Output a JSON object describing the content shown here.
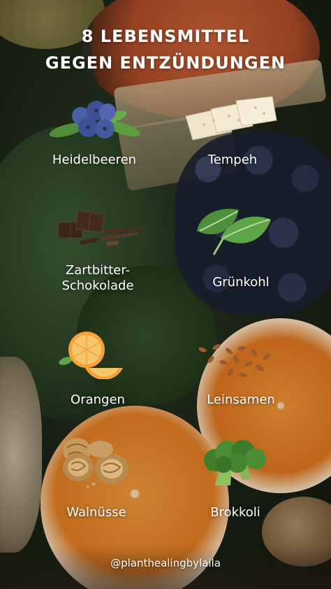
{
  "title": {
    "line1": "8 LEBENSMITTEL",
    "line2": "GEGEN ENTZÜNDUNGEN"
  },
  "foods": {
    "heidelbeeren": {
      "label": "Heidelbeeren",
      "icon": "blueberries-icon"
    },
    "tempeh": {
      "label": "Tempeh",
      "icon": "tempeh-icon"
    },
    "zartbitter": {
      "line1": "Zartbitter-",
      "line2": "Schokolade",
      "icon": "dark-chocolate-icon"
    },
    "gruenkohl": {
      "label": "Grünkohl",
      "icon": "kale-icon"
    },
    "orangen": {
      "label": "Orangen",
      "icon": "orange-slices-icon"
    },
    "leinsamen": {
      "label": "Leinsamen",
      "icon": "flaxseed-icon"
    },
    "walnuesse": {
      "label": "Walnüsse",
      "icon": "walnuts-icon"
    },
    "brokkoli": {
      "label": "Brokkoli",
      "icon": "broccoli-icon"
    }
  },
  "footer": {
    "handle": "@planthealingbylaila"
  },
  "colors": {
    "text": "#ffffff",
    "background": "#1a2316"
  }
}
